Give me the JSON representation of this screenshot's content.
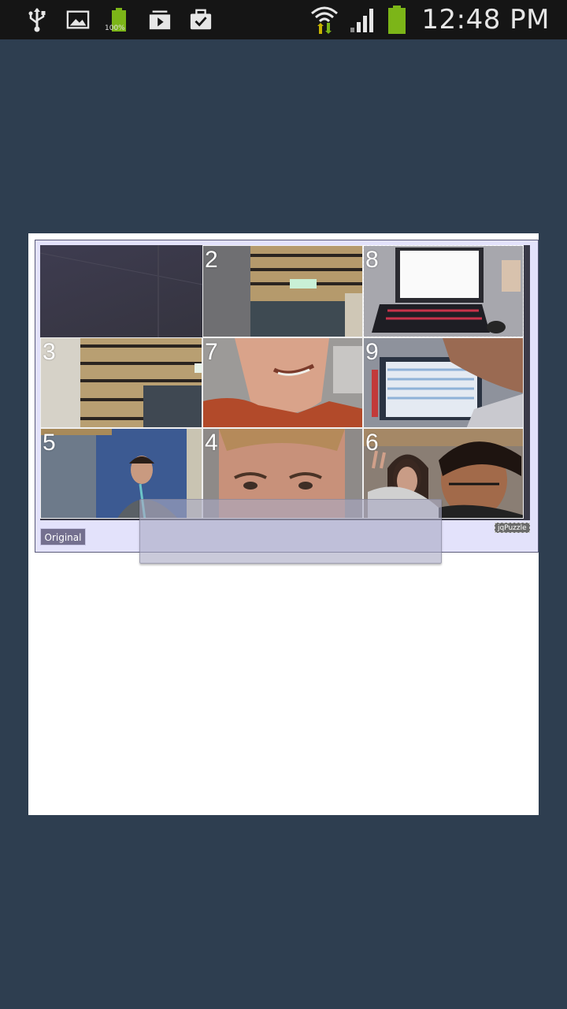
{
  "status_bar": {
    "left_icons": [
      "usb-icon",
      "image-icon",
      "battery-saver-icon",
      "media-icon",
      "briefcase-check-icon"
    ],
    "battery_small_label": "100%",
    "right_icons": [
      "wifi-icon",
      "signal-icon",
      "battery-icon"
    ],
    "time": "12:48 PM",
    "colors": {
      "battery": "#7cb518",
      "wifi_arrows": "#c8b400"
    }
  },
  "puzzle": {
    "tiles": [
      {
        "number": "",
        "empty": true
      },
      {
        "number": "2"
      },
      {
        "number": "8",
        "selected": true
      },
      {
        "number": "3"
      },
      {
        "number": "7"
      },
      {
        "number": "9"
      },
      {
        "number": "5"
      },
      {
        "number": "4"
      },
      {
        "number": "6"
      }
    ],
    "original_button": "Original",
    "badge": "jqPuzzle"
  }
}
